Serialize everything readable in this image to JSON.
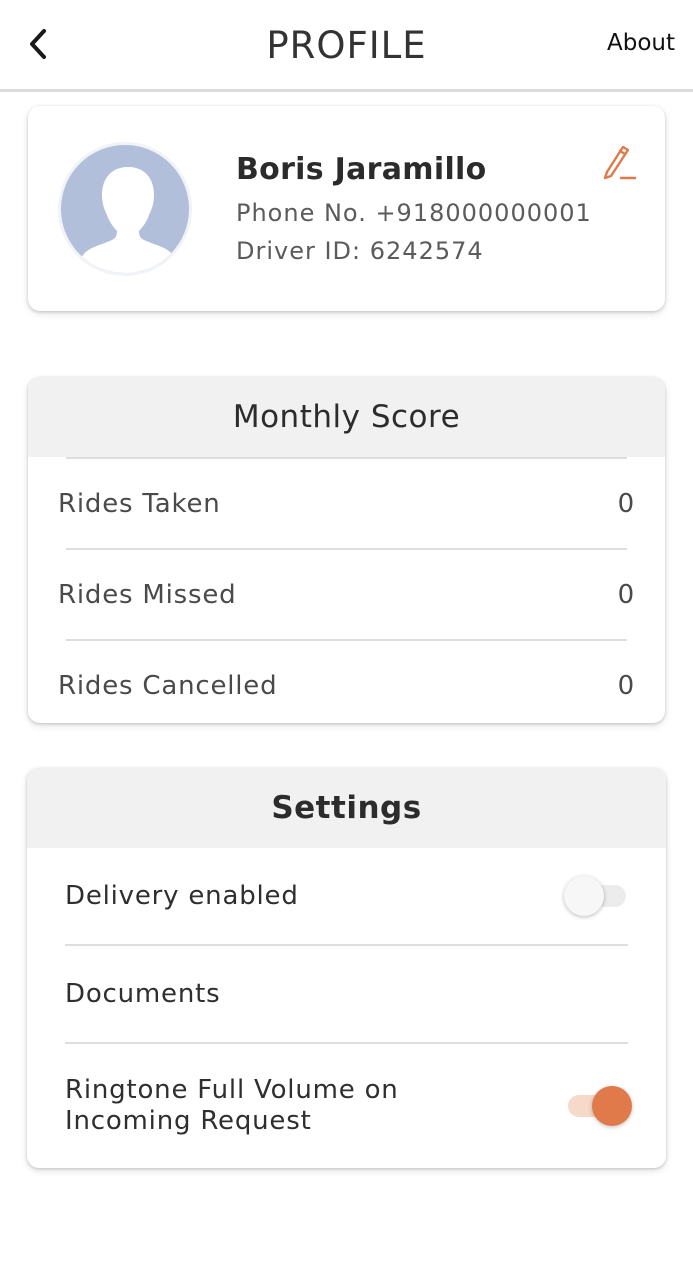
{
  "header": {
    "title": "PROFILE",
    "about_label": "About"
  },
  "profile": {
    "name": "Boris Jaramillo",
    "phone_line": "Phone No. +918000000001",
    "driver_id_line": "Driver ID: 6242574"
  },
  "monthly_score": {
    "title": "Monthly Score",
    "rows": [
      {
        "label": "Rides Taken",
        "value": "0"
      },
      {
        "label": "Rides Missed",
        "value": "0"
      },
      {
        "label": "Rides Cancelled",
        "value": "0"
      }
    ]
  },
  "settings": {
    "title": "Settings",
    "delivery_label": "Delivery enabled",
    "delivery_enabled": false,
    "documents_label": "Documents",
    "ringtone_line1": "Ringtone Full Volume on",
    "ringtone_line2": "Incoming Request",
    "ringtone_enabled": true
  },
  "colors": {
    "accent": "#e07a4a",
    "avatar_bg": "#b1bfda"
  },
  "icons": {
    "back": "chevron-left-icon",
    "edit": "pencil-icon",
    "avatar": "user-silhouette-icon"
  }
}
